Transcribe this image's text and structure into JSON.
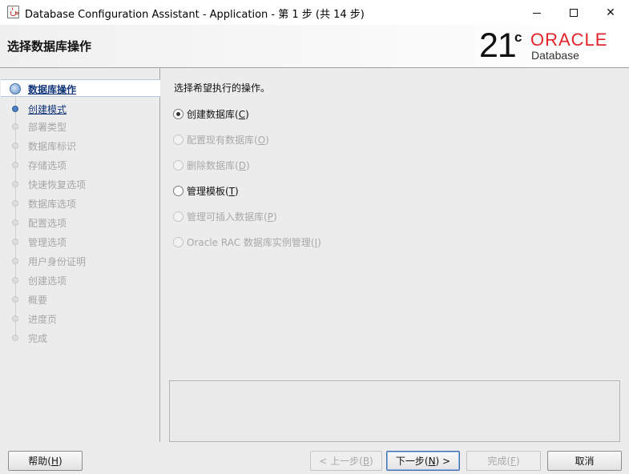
{
  "window": {
    "title": "Database Configuration Assistant - Application - 第 1 步 (共 14 步)",
    "icon": "java-cup-icon",
    "controls": [
      "minimize-icon",
      "maximize-icon",
      "close-icon"
    ],
    "close_glyph": "✕"
  },
  "header": {
    "title": "选择数据库操作",
    "logo": {
      "version": "21",
      "version_suffix": "c",
      "brand": "ORACLE",
      "product": "Database",
      "brand_color": "#e3242b"
    }
  },
  "nav": {
    "steps": [
      {
        "label": "数据库操作",
        "state": "current"
      },
      {
        "label": "创建模式",
        "state": "active"
      },
      {
        "label": "部署类型",
        "state": "disabled"
      },
      {
        "label": "数据库标识",
        "state": "disabled"
      },
      {
        "label": "存储选项",
        "state": "disabled"
      },
      {
        "label": "快速恢复选项",
        "state": "disabled"
      },
      {
        "label": "数据库选项",
        "state": "disabled"
      },
      {
        "label": "配置选项",
        "state": "disabled"
      },
      {
        "label": "管理选项",
        "state": "disabled"
      },
      {
        "label": "用户身份证明",
        "state": "disabled"
      },
      {
        "label": "创建选项",
        "state": "disabled"
      },
      {
        "label": "概要",
        "state": "disabled"
      },
      {
        "label": "进度页",
        "state": "disabled"
      },
      {
        "label": "完成",
        "state": "disabled"
      }
    ]
  },
  "main": {
    "prompt": "选择希望执行的操作。",
    "options": [
      {
        "label": "创建数据库(",
        "mnemonic": "C",
        "suffix": ")",
        "selected": true,
        "enabled": true
      },
      {
        "label": "配置现有数据库(",
        "mnemonic": "O",
        "suffix": ")",
        "selected": false,
        "enabled": false
      },
      {
        "label": "删除数据库(",
        "mnemonic": "D",
        "suffix": ")",
        "selected": false,
        "enabled": false
      },
      {
        "label": "管理模板(",
        "mnemonic": "T",
        "suffix": ")",
        "selected": false,
        "enabled": true
      },
      {
        "label": "管理可插入数据库(",
        "mnemonic": "P",
        "suffix": ")",
        "selected": false,
        "enabled": false
      },
      {
        "label": "Oracle RAC 数据库实例管理(",
        "mnemonic": "I",
        "suffix": ")",
        "selected": false,
        "enabled": false
      }
    ]
  },
  "buttons": {
    "help": {
      "label": "帮助(",
      "mnemonic": "H",
      "suffix": ")"
    },
    "back": {
      "label": "< 上一步(",
      "mnemonic": "B",
      "suffix": ")"
    },
    "next": {
      "label": "下一步(",
      "mnemonic": "N",
      "suffix": ") >"
    },
    "finish": {
      "label": "完成(",
      "mnemonic": "F",
      "suffix": ")"
    },
    "cancel": {
      "label": "取消"
    }
  }
}
